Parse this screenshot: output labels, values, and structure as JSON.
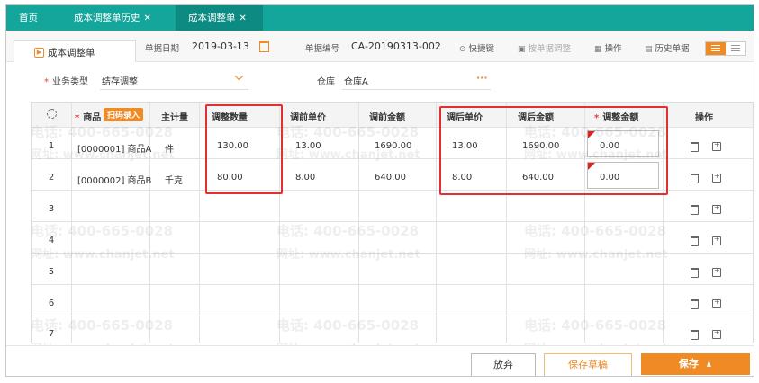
{
  "tabs": [
    {
      "label": "首页",
      "closable": false
    },
    {
      "label": "成本调整单历史",
      "closable": true
    },
    {
      "label": "成本调整单",
      "closable": true
    }
  ],
  "close_glyph": "✕",
  "toolbar": {
    "doc_type": "成本调整单",
    "date_label": "单据日期",
    "date_value": "2019-03-13",
    "number_label": "单据编号",
    "number_value": "CA-20190313-002",
    "shortcut": "快捷键",
    "adjust_by_doc": "按单据调整",
    "operation": "操作",
    "history": "历史单据"
  },
  "form": {
    "biz_type_label": "业务类型",
    "biz_type_value": "结存调整",
    "warehouse_label": "仓库",
    "warehouse_value": "仓库A"
  },
  "grid": {
    "headers": {
      "product": "商品",
      "scan": "扫码录入",
      "unit": "主计量",
      "adj_qty": "调整数量",
      "pre_price": "调前单价",
      "pre_amount": "调前金额",
      "post_price": "调后单价",
      "post_amount": "调后金额",
      "adj_amount": "调整金额",
      "ops": "操作"
    },
    "rows": [
      {
        "no": "1",
        "product": "[0000001] 商品A",
        "unit": "件",
        "adj_qty": "130.00",
        "pre_price": "13.00",
        "pre_amount": "1690.00",
        "post_price": "13.00",
        "post_amount": "1690.00",
        "adj_amount": "0.00"
      },
      {
        "no": "2",
        "product": "[0000002] 商品B",
        "unit": "千克",
        "adj_qty": "80.00",
        "pre_price": "8.00",
        "pre_amount": "640.00",
        "post_price": "8.00",
        "post_amount": "640.00",
        "adj_amount": "0.00"
      },
      {
        "no": "3"
      },
      {
        "no": "4"
      },
      {
        "no": "5"
      },
      {
        "no": "6"
      },
      {
        "no": "7"
      }
    ]
  },
  "footer": {
    "discard": "放弃",
    "save_draft": "保存草稿",
    "save": "保存",
    "save_caret": "∧"
  },
  "watermark": {
    "phone": "电话: 400-665-0028",
    "site": "网址: www.chanjet.net"
  },
  "colors": {
    "tab_bar": "#14a59b",
    "tab_active": "#0d8a82",
    "accent": "#f08a24",
    "highlight": "#e23030"
  }
}
